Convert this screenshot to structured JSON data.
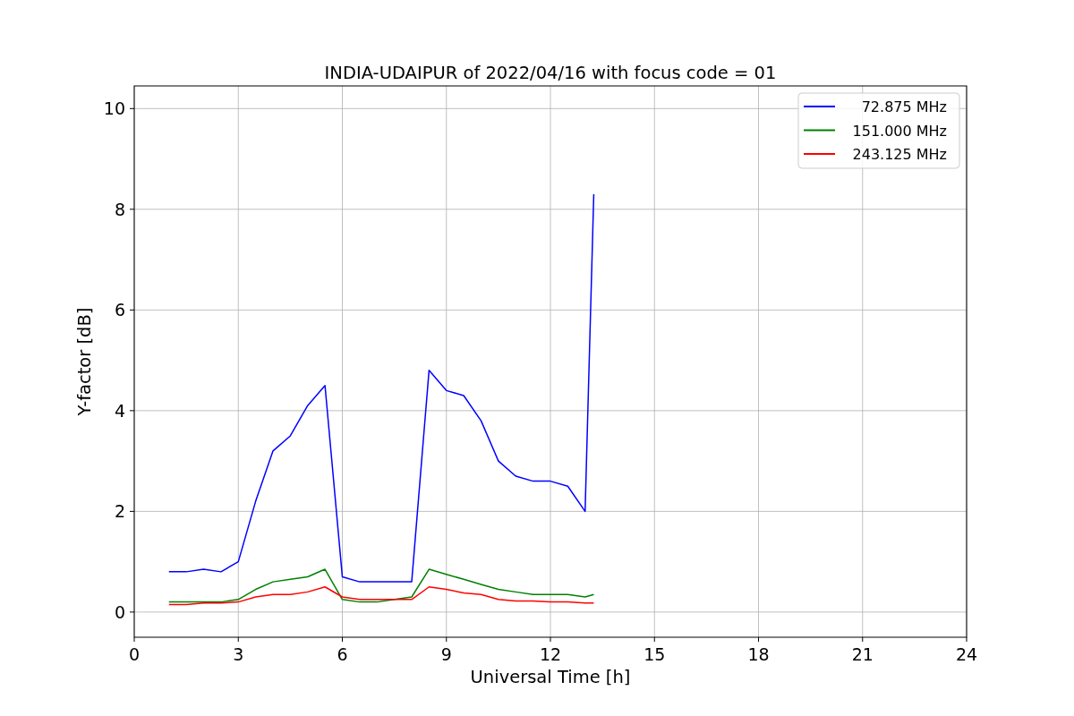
{
  "chart_data": {
    "type": "line",
    "title": "INDIA-UDAIPUR of 2022/04/16 with focus code = 01",
    "xlabel": "Universal Time [h]",
    "ylabel": "Y-factor [dB]",
    "x": [
      1,
      1.5,
      2,
      2.5,
      3,
      3.5,
      4,
      4.5,
      5,
      5.5,
      6,
      6.5,
      7,
      7.5,
      8,
      8.5,
      9,
      9.5,
      10,
      10.5,
      11,
      11.5,
      12,
      12.5,
      13,
      13.25
    ],
    "series": [
      {
        "name": "72.875 MHz",
        "color": "#0000ff",
        "values": [
          0.8,
          0.8,
          0.85,
          0.8,
          1.0,
          2.2,
          3.2,
          3.5,
          4.1,
          4.5,
          0.7,
          0.6,
          0.6,
          0.6,
          0.6,
          4.8,
          4.4,
          4.3,
          3.8,
          3.0,
          2.7,
          2.6,
          2.6,
          2.5,
          2.0,
          8.3
        ]
      },
      {
        "name": "151.000 MHz",
        "color": "#008000",
        "values": [
          0.2,
          0.2,
          0.2,
          0.2,
          0.25,
          0.45,
          0.6,
          0.65,
          0.7,
          0.85,
          0.25,
          0.2,
          0.2,
          0.25,
          0.3,
          0.85,
          0.75,
          0.65,
          0.55,
          0.45,
          0.4,
          0.35,
          0.35,
          0.35,
          0.3,
          0.35
        ]
      },
      {
        "name": "243.125 MHz",
        "color": "#ff0000",
        "values": [
          0.15,
          0.15,
          0.18,
          0.18,
          0.2,
          0.3,
          0.35,
          0.35,
          0.4,
          0.5,
          0.3,
          0.25,
          0.25,
          0.25,
          0.25,
          0.5,
          0.45,
          0.38,
          0.35,
          0.25,
          0.22,
          0.22,
          0.2,
          0.2,
          0.18,
          0.18
        ]
      }
    ],
    "xlim": [
      0,
      24
    ],
    "ylim": [
      -0.5,
      10.45
    ],
    "xticks": [
      0,
      3,
      6,
      9,
      12,
      15,
      18,
      21,
      24
    ],
    "yticks": [
      0,
      2,
      4,
      6,
      8,
      10
    ],
    "grid": true,
    "legend": true
  }
}
